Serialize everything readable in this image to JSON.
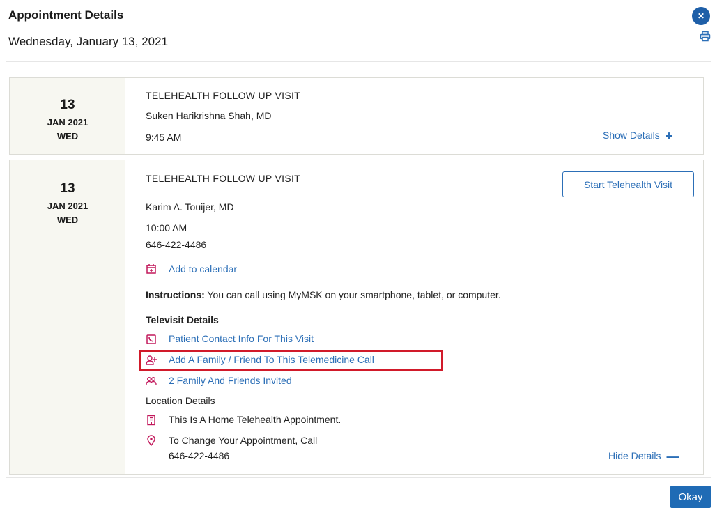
{
  "header": {
    "title": "Appointment Details",
    "date": "Wednesday, January 13, 2021"
  },
  "icons": {
    "close": "close-icon",
    "print": "print-icon"
  },
  "appointments": [
    {
      "day": "13",
      "month_year": "JAN 2021",
      "weekday": "WED",
      "visit_type": "TELEHEALTH FOLLOW UP VISIT",
      "provider": "Suken Harikrishna Shah, MD",
      "time": "9:45 AM",
      "toggle_label": "Show Details",
      "toggle_symbol": "+"
    },
    {
      "day": "13",
      "month_year": "JAN 2021",
      "weekday": "WED",
      "visit_type": "TELEHEALTH FOLLOW UP VISIT",
      "start_button": "Start Telehealth Visit",
      "provider": "Karim A. Touijer, MD",
      "time": "10:00 AM",
      "phone": "646-422-4486",
      "add_calendar": "Add to calendar",
      "instructions_label": "Instructions:",
      "instructions_text": " You can call using MyMSK on your smartphone, tablet, or computer.",
      "televisit_heading": "Televisit Details",
      "patient_contact": "Patient Contact Info For This Visit",
      "add_family": "Add A Family / Friend To This Telemedicine Call",
      "family_invited": "2 Family And Friends Invited",
      "location_heading": "Location Details",
      "location_text": "This Is A Home Telehealth Appointment.",
      "change_text": "To Change Your Appointment, Call",
      "change_phone": "646-422-4486",
      "toggle_label": "Hide Details",
      "toggle_symbol": "—"
    }
  ],
  "footer": {
    "okay_label": "Okay"
  },
  "colors": {
    "accent": "#2c6fb7",
    "icon": "#c2185b",
    "highlight": "#d11a2a",
    "date_bg": "#f7f7f1"
  }
}
